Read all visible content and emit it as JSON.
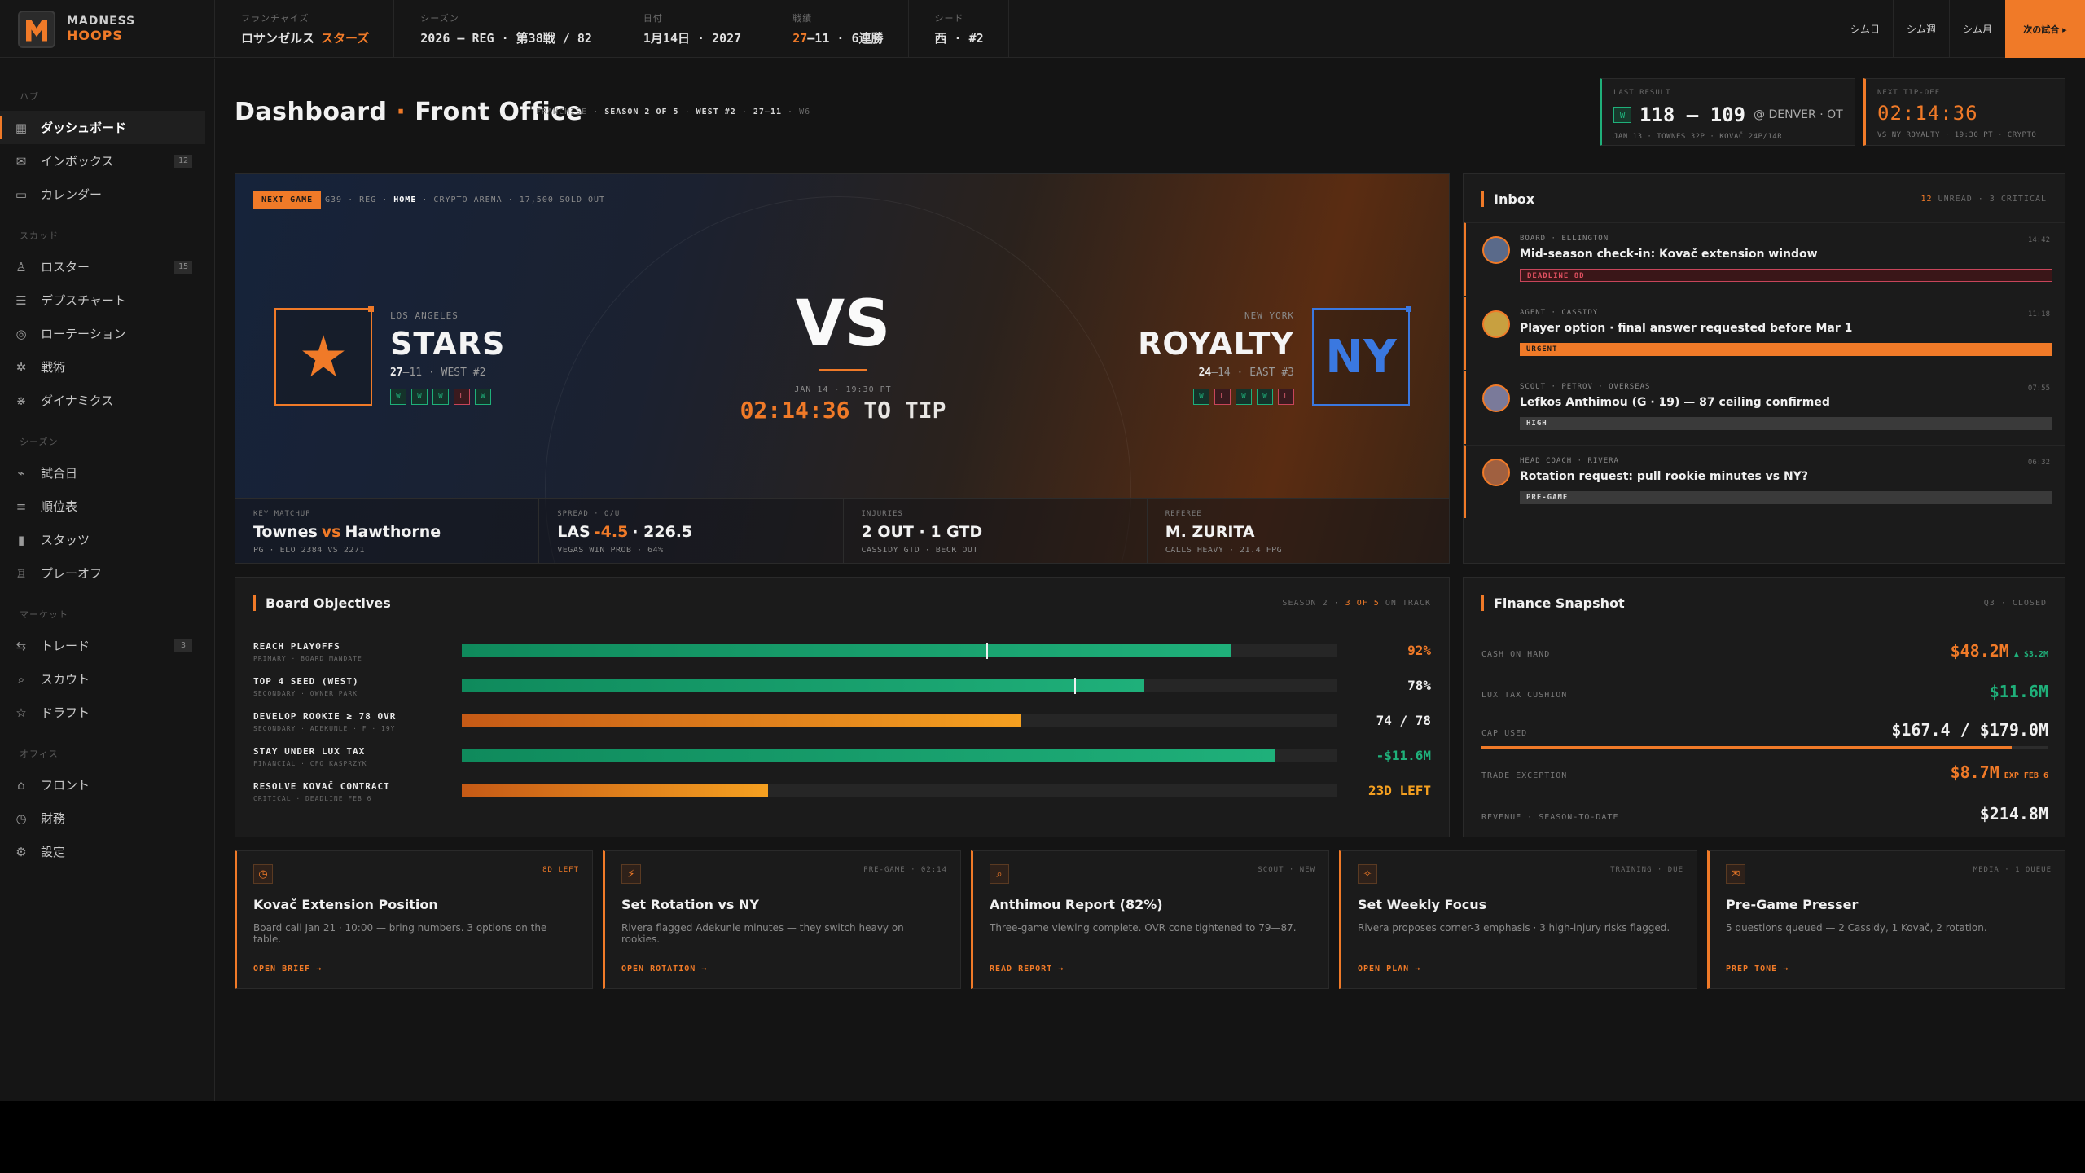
{
  "brand": {
    "line1": "MADNESS",
    "line2": "HOOPS"
  },
  "header": {
    "meta": [
      {
        "key": "フランチャイズ",
        "value_a": "ロサンゼルス",
        "value_b": "スターズ"
      },
      {
        "key": "シーズン",
        "value_a": "2026 — REG · 第38戦 / 82",
        "value_b": ""
      },
      {
        "key": "日付",
        "value_a": "1月14日 · 2027",
        "value_b": ""
      },
      {
        "key": "戦績",
        "value_a": "27",
        "value_b": "–11 · 6連勝"
      },
      {
        "key": "シード",
        "value_a": "西 · #2",
        "value_b": ""
      }
    ],
    "sim_buttons": [
      "シム日",
      "シム週",
      "シム月"
    ],
    "next_game": "次の試合 ▸"
  },
  "sidebar": {
    "sections": [
      {
        "title": "ハブ",
        "items": [
          {
            "label": "ダッシュボード",
            "icon": "grid-icon",
            "active": true
          },
          {
            "label": "インボックス",
            "icon": "mail-icon",
            "badge": "12"
          },
          {
            "label": "カレンダー",
            "icon": "calendar-icon"
          }
        ]
      },
      {
        "title": "スカッド",
        "items": [
          {
            "label": "ロスター",
            "icon": "user-icon",
            "badge": "15"
          },
          {
            "label": "デプスチャート",
            "icon": "layers-icon"
          },
          {
            "label": "ローテーション",
            "icon": "rotation-icon"
          },
          {
            "label": "戦術",
            "icon": "tactics-icon"
          },
          {
            "label": "ダイナミクス",
            "icon": "dynamics-icon"
          }
        ]
      },
      {
        "title": "シーズン",
        "items": [
          {
            "label": "試合日",
            "icon": "pulse-icon"
          },
          {
            "label": "順位表",
            "icon": "list-icon"
          },
          {
            "label": "スタッツ",
            "icon": "bar-chart-icon"
          },
          {
            "label": "プレーオフ",
            "icon": "trophy-icon"
          }
        ]
      },
      {
        "title": "マーケット",
        "items": [
          {
            "label": "トレード",
            "icon": "swap-icon",
            "badge": "3"
          },
          {
            "label": "スカウト",
            "icon": "search-icon"
          },
          {
            "label": "ドラフト",
            "icon": "star-icon"
          }
        ]
      },
      {
        "title": "オフィス",
        "items": [
          {
            "label": "フロント",
            "icon": "building-icon"
          },
          {
            "label": "財務",
            "icon": "clock-icon"
          },
          {
            "label": "設定",
            "icon": "gear-icon"
          }
        ]
      }
    ]
  },
  "page": {
    "title_a": "Dashboard",
    "dot": "·",
    "title_b": "Front Office",
    "crumbs": {
      "a": "FRANCHISE ·",
      "b": "SEASON 2 OF 5",
      "c": "·",
      "d": "WEST #2",
      "e": "·",
      "f": "27–11",
      "g": "· W6"
    }
  },
  "last_result": {
    "label": "LAST RESULT",
    "wl": "W",
    "score": "118 — 109",
    "opp": "@ DENVER · OT",
    "sub": "JAN 13 · TOWNES 32P · KOVAČ 24P/14R"
  },
  "next_tip": {
    "label": "NEXT TIP-OFF",
    "clock": "02:14:36",
    "sub": "VS NY ROYALTY · 19:30 PT · CRYPTO"
  },
  "hero": {
    "chip": "NEXT GAME",
    "meta_a": "G39 · REG ·",
    "meta_b": "HOME",
    "meta_c": "· CRYPTO ARENA · 17,500 SOLD OUT",
    "home": {
      "city": "LOS ANGELES",
      "name": "STARS",
      "rec_a": "27",
      "rec_b": "–11 · WEST #2",
      "form": [
        "W",
        "W",
        "W",
        "L",
        "W"
      ],
      "color": "#f07a28"
    },
    "away": {
      "city": "NEW YORK",
      "name": "ROYALTY",
      "rec_a": "24",
      "rec_b": "–14 · EAST #3",
      "form": [
        "W",
        "L",
        "W",
        "W",
        "L"
      ],
      "logo": "NY",
      "color": "#3a78e0"
    },
    "vs": "VS",
    "date": "JAN 14 · 19:30 PT",
    "countdown": "02:14:36",
    "to_tip": "TO TIP",
    "stats": [
      {
        "key": "KEY MATCHUP",
        "v1": "Townes",
        "v2": "vs",
        "v3": "Hawthorne",
        "sub": "PG · ELO 2384 VS 2271"
      },
      {
        "key": "SPREAD · O/U",
        "v1": "LAS",
        "v2": "-4.5",
        "v3": "· 226.5",
        "sub": "VEGAS WIN PROB · 64%"
      },
      {
        "key": "INJURIES",
        "v1": "2 OUT · 1 GTD",
        "v2": "",
        "v3": "",
        "sub": "CASSIDY GTD · BECK OUT"
      },
      {
        "key": "REFEREE",
        "v1": "M. ZURITA",
        "v2": "",
        "v3": "",
        "sub": "CALLS HEAVY · 21.4 FPG"
      }
    ]
  },
  "inbox": {
    "title": "Inbox",
    "unread": "12",
    "summary": "UNREAD · 3 CRITICAL",
    "messages": [
      {
        "from": "BOARD · ELLINGTON",
        "title": "Mid-season check-in: Kovač extension window",
        "time": "14:42",
        "tag": "DEADLINE 8D",
        "tag_style": "outline",
        "avatar": "#5a6a8a"
      },
      {
        "from": "AGENT · CASSIDY",
        "title": "Player option · final answer requested before Mar 1",
        "time": "11:18",
        "tag": "URGENT",
        "tag_style": "solid",
        "avatar": "#c8a040"
      },
      {
        "from": "SCOUT · PETROV · OVERSEAS",
        "title": "Lefkos Anthimou (G · 19) — 87 ceiling confirmed",
        "time": "07:55",
        "tag": "HIGH",
        "tag_style": "grey",
        "avatar": "#7a7a9a"
      },
      {
        "from": "HEAD COACH · RIVERA",
        "title": "Rotation request: pull rookie minutes vs NY?",
        "time": "06:32",
        "tag": "PRE-GAME",
        "tag_style": "grey",
        "avatar": "#a06040"
      }
    ]
  },
  "objectives": {
    "title": "Board Objectives",
    "summary_a": "SEASON 2 ·",
    "summary_b": "3 OF 5",
    "summary_c": "ON TRACK",
    "rows": [
      {
        "name": "REACH PLAYOFFS",
        "sub": "PRIMARY · BOARD MANDATE",
        "value": "92%",
        "progress": 0.88,
        "marker": 0.6,
        "style": "g",
        "val_color": "#f07a28"
      },
      {
        "name": "TOP 4 SEED (WEST)",
        "sub": "SECONDARY · OWNER PARK",
        "value": "78%",
        "progress": 0.78,
        "marker": 0.7,
        "style": "g",
        "val_color": "#f0f0f0"
      },
      {
        "name": "DEVELOP ROOKIE ≥ 78 OVR",
        "sub": "SECONDARY · ADEKUNLE · F · 19Y",
        "value": "74 / 78",
        "progress": 0.64,
        "marker": null,
        "style": "o",
        "val_color": "#f0f0f0"
      },
      {
        "name": "STAY UNDER LUX TAX",
        "sub": "FINANCIAL · CFO KASPRZYK",
        "value": "-$11.6M",
        "progress": 0.93,
        "marker": null,
        "style": "g",
        "val_color": "#1fb07a"
      },
      {
        "name": "RESOLVE KOVAČ CONTRACT",
        "sub": "CRITICAL · DEADLINE FEB 6",
        "value": "23D LEFT",
        "progress": 0.35,
        "marker": null,
        "style": "o",
        "val_color": "#f5a020"
      }
    ]
  },
  "finance": {
    "title": "Finance Snapshot",
    "summary": "Q3 · CLOSED",
    "rows": [
      {
        "key": "CASH ON HAND",
        "value": "$48.2M",
        "extra": " ▲ $3.2M",
        "color": "#f07a28",
        "extra_color": "#1fb07a"
      },
      {
        "key": "LUX TAX CUSHION",
        "value": "$11.6M",
        "extra": "",
        "color": "#1fb07a",
        "extra_color": ""
      },
      {
        "key": "CAP USED",
        "value": "$167.4 / $179.0M",
        "extra": "",
        "color": "#f0f0f0",
        "extra_color": ""
      },
      {
        "key": "TRADE EXCEPTION",
        "value": "$8.7M",
        "extra": " EXP FEB 6",
        "color": "#f07a28",
        "extra_color": "#f07a28"
      },
      {
        "key": "REVENUE · SEASON-TO-DATE",
        "value": "$214.8M",
        "extra": "",
        "color": "#f0f0f0",
        "extra_color": ""
      }
    ],
    "cap_progress": 0.935
  },
  "actions": [
    {
      "icon": "clock-icon",
      "glyph": "◷",
      "tag": "8D LEFT",
      "tag_or": true,
      "title": "Kovač Extension Position",
      "desc": "Board call Jan 21 · 10:00 — bring numbers. 3 options on the table.",
      "link": "OPEN BRIEF →"
    },
    {
      "icon": "pulse-icon",
      "glyph": "⚡",
      "tag": "PRE-GAME · 02:14",
      "tag_or": false,
      "title": "Set Rotation vs NY",
      "desc": "Rivera flagged Adekunle minutes — they switch heavy on rookies.",
      "link": "OPEN ROTATION →"
    },
    {
      "icon": "search-icon",
      "glyph": "⌕",
      "tag": "SCOUT · NEW",
      "tag_or": false,
      "title": "Anthimou Report (82%)",
      "desc": "Three-game viewing complete. OVR cone tightened to 79—87.",
      "link": "READ REPORT →"
    },
    {
      "icon": "spark-icon",
      "glyph": "✧",
      "tag": "TRAINING · DUE",
      "tag_or": false,
      "title": "Set Weekly Focus",
      "desc": "Rivera proposes corner-3 emphasis · 3 high-injury risks flagged.",
      "link": "OPEN PLAN →"
    },
    {
      "icon": "mail-icon",
      "glyph": "✉",
      "tag": "MEDIA · 1 QUEUE",
      "tag_or": false,
      "title": "Pre-Game Presser",
      "desc": "5 questions queued — 2 Cassidy, 1 Kovač, 2 rotation.",
      "link": "PREP TONE →"
    }
  ]
}
